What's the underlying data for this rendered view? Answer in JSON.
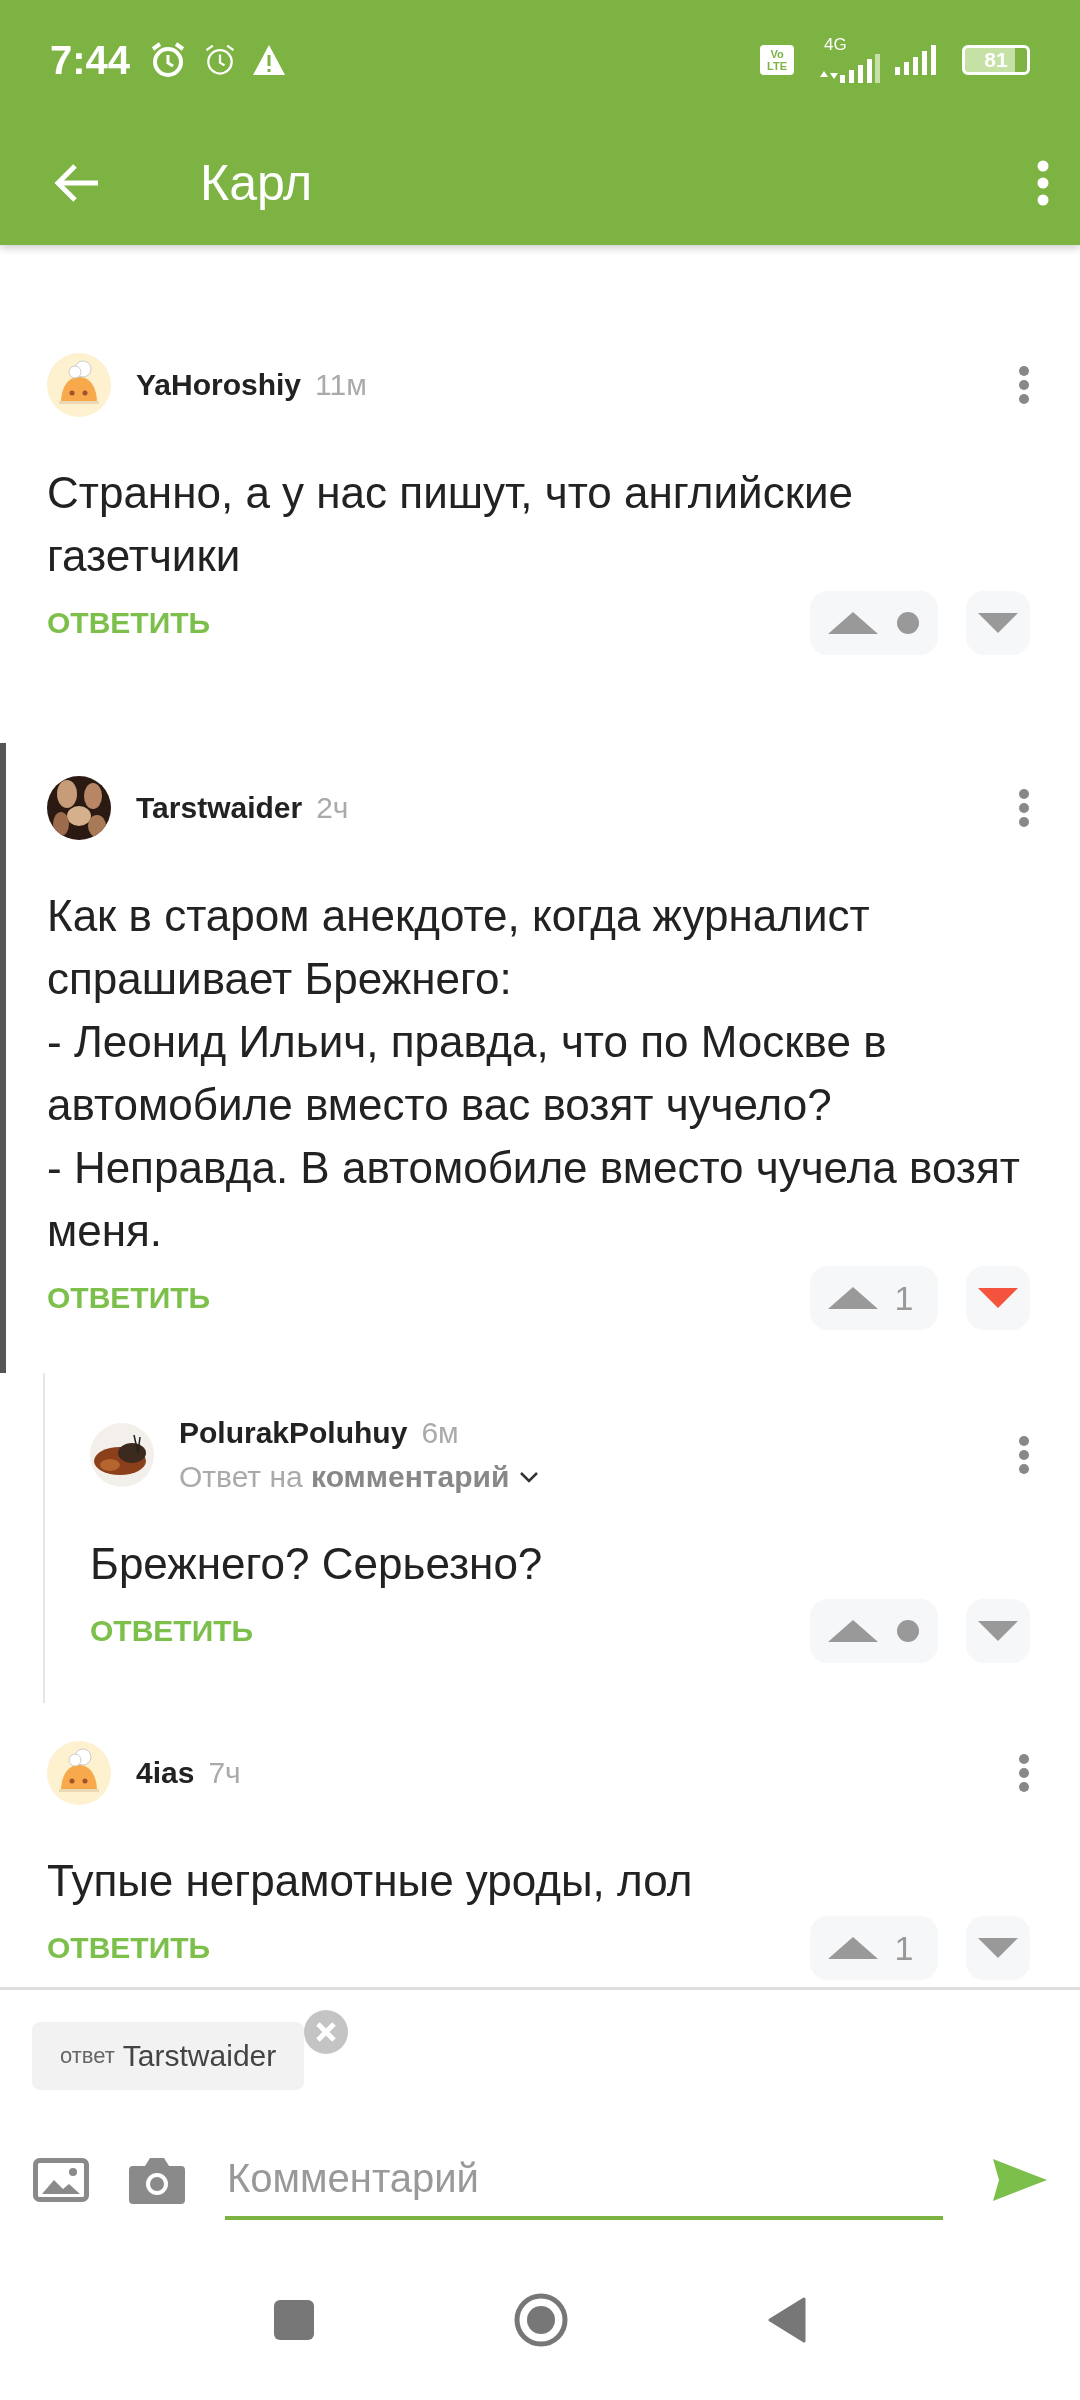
{
  "status_bar": {
    "time": "7:44",
    "volte": [
      "Vo",
      "LTE"
    ],
    "network": "4G",
    "battery": "81"
  },
  "toolbar": {
    "title": "Карл"
  },
  "comments": [
    {
      "kind": "top",
      "highlighted": false,
      "avatar": {
        "kind": "default"
      },
      "author": "YaHoroshiy",
      "time": "11м",
      "text": "Странно, а у нас пишут, что английские газетчики",
      "reply_label": "ОТВЕТИТЬ",
      "votes": {
        "downvoted": false
      }
    },
    {
      "kind": "top",
      "highlighted": true,
      "author": "Tarstwaider",
      "time": "2ч",
      "text": "Как в старом анекдоте, когда журналист спрашивает Брежнего:\n- Леонид Ильич, правда, что по Москве в автомобиле вместо вас возят чучело?\n- Неправда. В автомобиле вместо чучела возят меня.",
      "reply_label": "ОТВЕТИТЬ",
      "votes": {
        "rating": "1",
        "downvoted": true
      }
    },
    {
      "kind": "reply",
      "highlighted": false,
      "author": "PolurakPoluhuy",
      "time": "6м",
      "reply_to": "Ответ на **комментарий**",
      "text": "Брежнего? Серьезно?",
      "reply_label": "ОТВЕТИТЬ",
      "votes": {
        "downvoted": false
      }
    },
    {
      "kind": "top",
      "highlighted": false,
      "avatar": {
        "kind": "default"
      },
      "author": "4ias",
      "time": "7ч",
      "text": "Тупые неграмотные уроды, лол",
      "reply_label": "ОТВЕТИТЬ",
      "votes": {
        "rating": "1",
        "downvoted": false
      }
    }
  ],
  "composer": {
    "reply_chip": {
      "prefix": "ответ",
      "name": "Tarstwaider"
    },
    "placeholder": "Комментарий"
  }
}
